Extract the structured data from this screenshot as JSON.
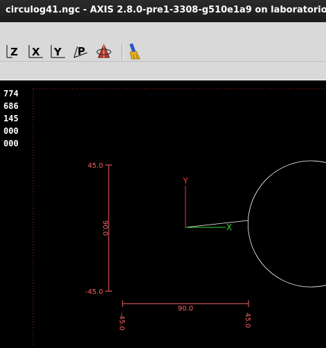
{
  "window": {
    "title": "circulog41.ngc - AXIS 2.8.0-pre1-3308-g510e1a9 on laboratorio"
  },
  "toolbar": {
    "buttons": [
      {
        "label": "Z",
        "icon": "view-z-icon"
      },
      {
        "label": "X",
        "icon": "view-x-icon"
      },
      {
        "label": "Y",
        "icon": "view-y-icon"
      },
      {
        "label": "P",
        "icon": "view-p-icon"
      },
      {
        "label": "",
        "icon": "rotate-view-icon"
      },
      {
        "label": "",
        "icon": "clear-plot-brush-icon"
      }
    ]
  },
  "dro": {
    "lines": [
      "774",
      "686",
      "145",
      "000",
      "000"
    ]
  },
  "plot": {
    "y_top_label": "45.0",
    "y_bottom_label": "-45.0",
    "y_extent_label": "90.0",
    "x_extent_label": "90.0",
    "x_left_label": "-45.0",
    "x_right_label": "45.0",
    "axis_x_label": "X",
    "axis_y_label": "Y",
    "colors": {
      "dimension": "#ff6464",
      "toolpath": "#ffffff",
      "x_axis": "#33dd33",
      "y_axis": "#ff3333",
      "limit": "#cc2222"
    }
  }
}
